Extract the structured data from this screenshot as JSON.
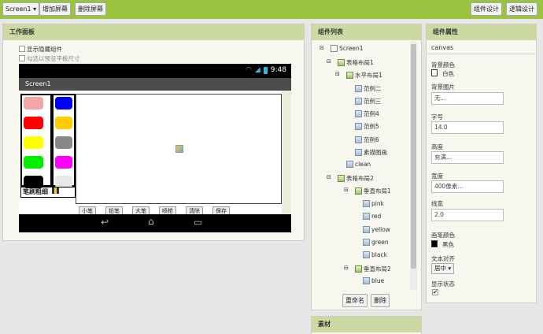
{
  "toolbar": {
    "screen_select": "Screen1",
    "add_screen": "增加屏幕",
    "remove_screen": "删除屏幕",
    "designer": "组件设计",
    "blocks": "逻辑设计"
  },
  "viewer": {
    "title": "工作面板",
    "show_hidden": "显示隐藏组件",
    "tablet_size": "勾选以预览平板尺寸",
    "phone": {
      "time": "9:48",
      "screen_title": "Screen1",
      "brush_label": "笔刷粗细",
      "bottom_labels": [
        "小笔",
        "铅笔",
        "大笔",
        "喷枪",
        "清除",
        "保存"
      ],
      "left_colors": [
        "#f4a6a6",
        "#ff0000",
        "#ffff00",
        "#00ee00",
        "#000000"
      ],
      "right_colors": [
        "#0000ff",
        "#ffcc00",
        "#888888",
        "#ff00ff",
        "#e8e8e8"
      ]
    }
  },
  "components": {
    "title": "组件列表",
    "tree": [
      {
        "label": "Screen1",
        "icon": "screen"
      },
      {
        "label": "表格布局1",
        "icon": "layout"
      },
      {
        "label": "水平布局1",
        "icon": "layout"
      },
      {
        "label": "范例二",
        "icon": "component"
      },
      {
        "label": "范例三",
        "icon": "component"
      },
      {
        "label": "范例4",
        "icon": "component"
      },
      {
        "label": "范例5",
        "icon": "component"
      },
      {
        "label": "范例6",
        "icon": "component"
      },
      {
        "label": "素描图画",
        "icon": "component"
      },
      {
        "label": "clean",
        "icon": "component"
      },
      {
        "label": "表格布局2",
        "icon": "layout"
      },
      {
        "label": "垂直布局1",
        "icon": "layout"
      },
      {
        "label": "pink",
        "icon": "component"
      },
      {
        "label": "red",
        "icon": "component"
      },
      {
        "label": "yellow",
        "icon": "component"
      },
      {
        "label": "green",
        "icon": "component"
      },
      {
        "label": "black",
        "icon": "component"
      },
      {
        "label": "垂直布局2",
        "icon": "layout"
      },
      {
        "label": "blue",
        "icon": "component"
      }
    ],
    "rename": "重命名",
    "delete": "删除",
    "media_title": "素材"
  },
  "properties": {
    "title": "组件属性",
    "component": "canvas",
    "bg_color_label": "背景颜色",
    "bg_color_value": "白色",
    "bg_image_label": "背景图片",
    "bg_image_value": "无...",
    "font_size_label": "字号",
    "font_size_value": "14.0",
    "height_label": "高度",
    "height_value": "充满...",
    "width_label": "宽度",
    "width_value": "400像素...",
    "line_width_label": "线宽",
    "line_width_value": "2.0",
    "paint_color_label": "画笔颜色",
    "paint_color_value": "黑色",
    "text_align_label": "文本对齐",
    "text_align_value": "居中",
    "visible_label": "显示状态"
  },
  "colors": {
    "accent": "#9ac33f",
    "panel_header": "#cdd9a2"
  }
}
